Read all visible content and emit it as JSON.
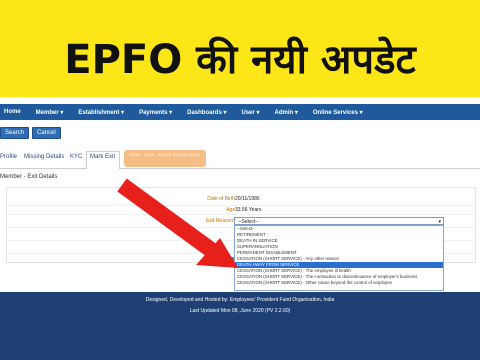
{
  "banner": {
    "title": "EPFO की नयी अपडेट"
  },
  "navbar": {
    "items": [
      "Home",
      "Member",
      "Establishment",
      "Payments",
      "Dashboards",
      "User",
      "Admin",
      "Online Services"
    ]
  },
  "actions": {
    "search_label": "Search",
    "cancel_label": "Cancel"
  },
  "subnav": {
    "tabs": [
      "Profile",
      "Missing Details",
      "KYC",
      "Mark Exit"
    ],
    "note": "XXXX - XXXX - XXXXX XXXXX XXXXX"
  },
  "section": {
    "title": "Member - Exit Details"
  },
  "form": {
    "dob_label": "Date of Birth",
    "dob_value": "20/11/1986",
    "age_label": "Age",
    "age_value": "33.56 Years",
    "exit_reason_label": "Exit Reason*",
    "select_value": "--Select--",
    "options": [
      "--Select--",
      "RETIREMENT",
      "DEATH IN SERVICE",
      "SUPERANNUATION",
      "PERMANENT DISABLEMENT",
      "CESSATION (SHORT SERVICE) - Any other reason",
      "DEATH AWAY FROM SERVICE",
      "CESSATION (SHORT SERVICE) - The employee ill health",
      "CESSATION (SHORT SERVICE) - The contraction or discontinuance of employer's business",
      "CESSATION (SHORT SERVICE) - Other cause beyond the control of employee"
    ],
    "selected_index": 6
  },
  "footer": {
    "line1": "Designed, Developed and Hosted by: Employees' Provident Fund Organisation, India",
    "line2": "Last Updated Mon 08, June 2020 (PV 2.2.60)"
  },
  "colors": {
    "banner_bg": "#fde617",
    "navbar_bg": "#1e5a9c",
    "footer_bg": "#1d3f73",
    "arrow": "#e8201c",
    "selected_option": "#2b6ed2"
  }
}
